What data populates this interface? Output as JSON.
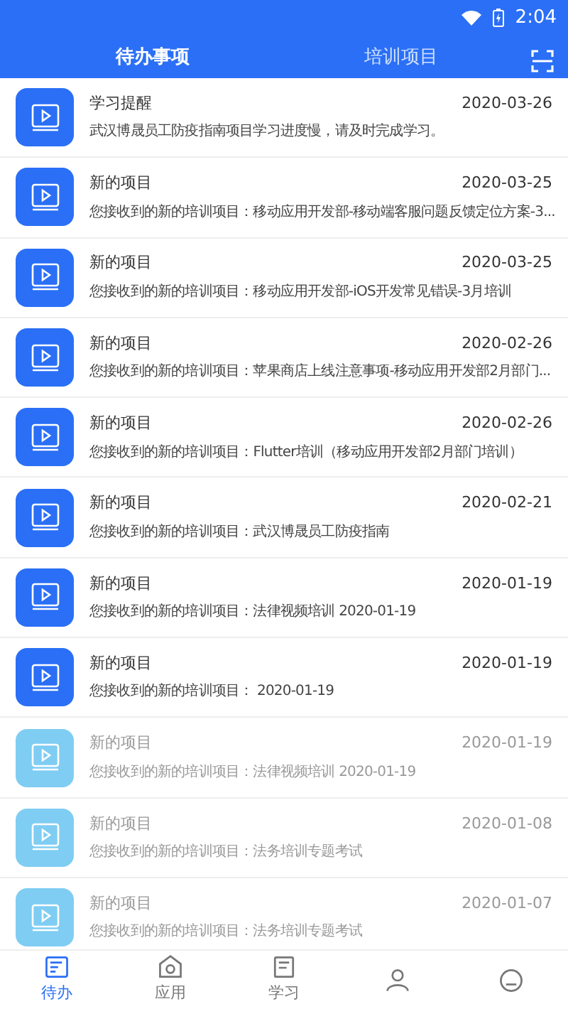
{
  "status_bar": {
    "time": "2:04"
  },
  "tabs": [
    {
      "label": "待办事项",
      "selected": true
    },
    {
      "label": "培训项目",
      "selected": false
    }
  ],
  "items": [
    {
      "title": "学习提醒",
      "date": "2020-03-26",
      "text": "武汉博晟员工防疫指南项目学习进度慢，请及时完成学习。",
      "read": false
    },
    {
      "title": "新的项目",
      "date": "2020-03-25",
      "text": "您接收到的新的培训项目：移动应用开发部-移动端客服问题反馈定位方案-3...",
      "read": false
    },
    {
      "title": "新的项目",
      "date": "2020-03-25",
      "text": "您接收到的新的培训项目：移动应用开发部-iOS开发常见错误-3月培训",
      "read": false
    },
    {
      "title": "新的项目",
      "date": "2020-02-26",
      "text": "您接收到的新的培训项目：苹果商店上线注意事项-移动应用开发部2月部门...",
      "read": false
    },
    {
      "title": "新的项目",
      "date": "2020-02-26",
      "text": "您接收到的新的培训项目：Flutter培训（移动应用开发部2月部门培训）",
      "read": false
    },
    {
      "title": "新的项目",
      "date": "2020-02-21",
      "text": "您接收到的新的培训项目：武汉博晟员工防疫指南",
      "read": false
    },
    {
      "title": "新的项目",
      "date": "2020-01-19",
      "text": "您接收到的新的培训项目：法律视频培训 2020-01-19",
      "read": false
    },
    {
      "title": "新的项目",
      "date": "2020-01-19",
      "text": "您接收到的新的培训项目： 2020-01-19",
      "read": false
    },
    {
      "title": "新的项目",
      "date": "2020-01-19",
      "text": "您接收到的新的培训项目：法律视频培训 2020-01-19",
      "read": true
    },
    {
      "title": "新的项目",
      "date": "2020-01-08",
      "text": "您接收到的新的培训项目：法务培训专题考试",
      "read": true
    },
    {
      "title": "新的项目",
      "date": "2020-01-07",
      "text": "您接收到的新的培训项目：法务培训专题考试",
      "read": true
    }
  ],
  "bottom_nav": [
    {
      "kind": "todo",
      "label": "待办",
      "selected": true
    },
    {
      "kind": "apps",
      "label": "应用",
      "selected": false
    },
    {
      "kind": "study",
      "label": "学习",
      "selected": false
    },
    {
      "kind": "person",
      "selected": false
    },
    {
      "kind": "profile",
      "selected": false
    }
  ]
}
